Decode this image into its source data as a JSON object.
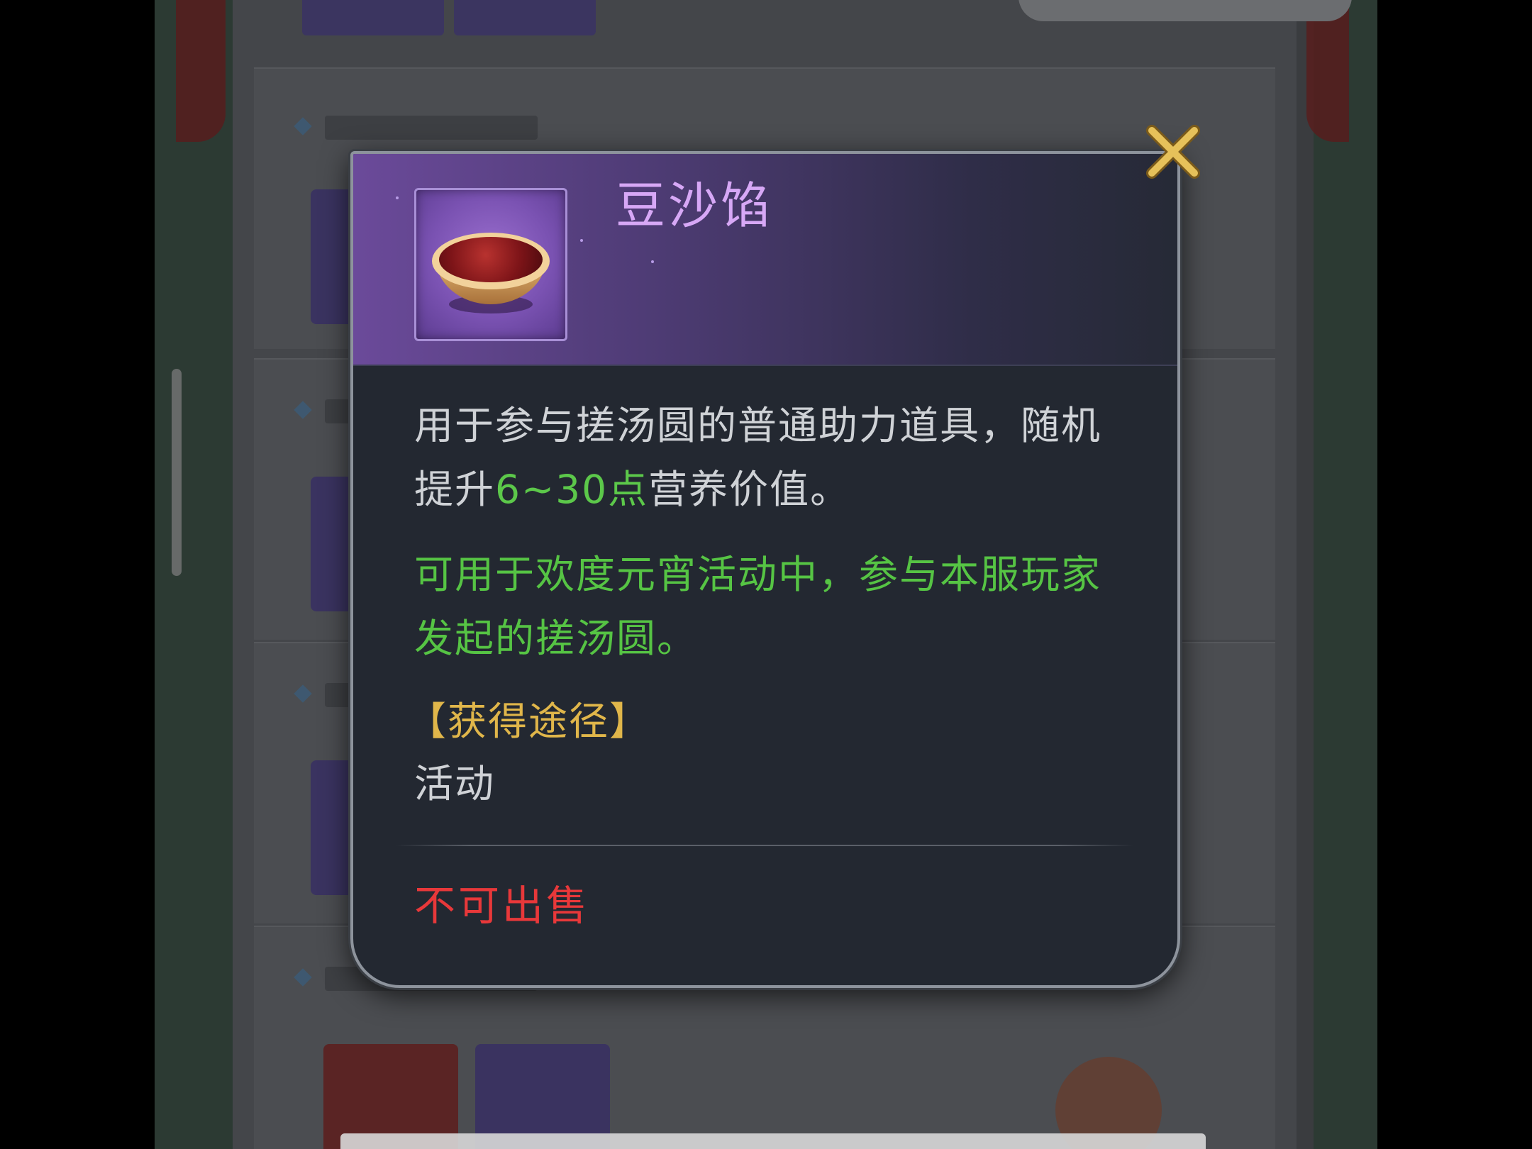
{
  "popup": {
    "item_name": "豆沙馅",
    "item_icon": "red-bean-paste-bowl-icon",
    "description": {
      "part1": "用于参与搓汤圆的普通助力道具，随机提升",
      "highlight": "6~30点",
      "part2": "营养价值。"
    },
    "usage_note": "可用于欢度元宵活动中，参与本服玩家发起的搓汤圆。",
    "source_title": "【获得途径】",
    "source_value": "活动",
    "sell_status": "不可出售",
    "close_icon": "close-x-icon"
  },
  "colors": {
    "item_name": "#d7a8f6",
    "highlight_green": "#5cc84a",
    "source_gold": "#e0b64a",
    "sell_red": "#e8383a",
    "close_gold": "#e6c15a"
  }
}
